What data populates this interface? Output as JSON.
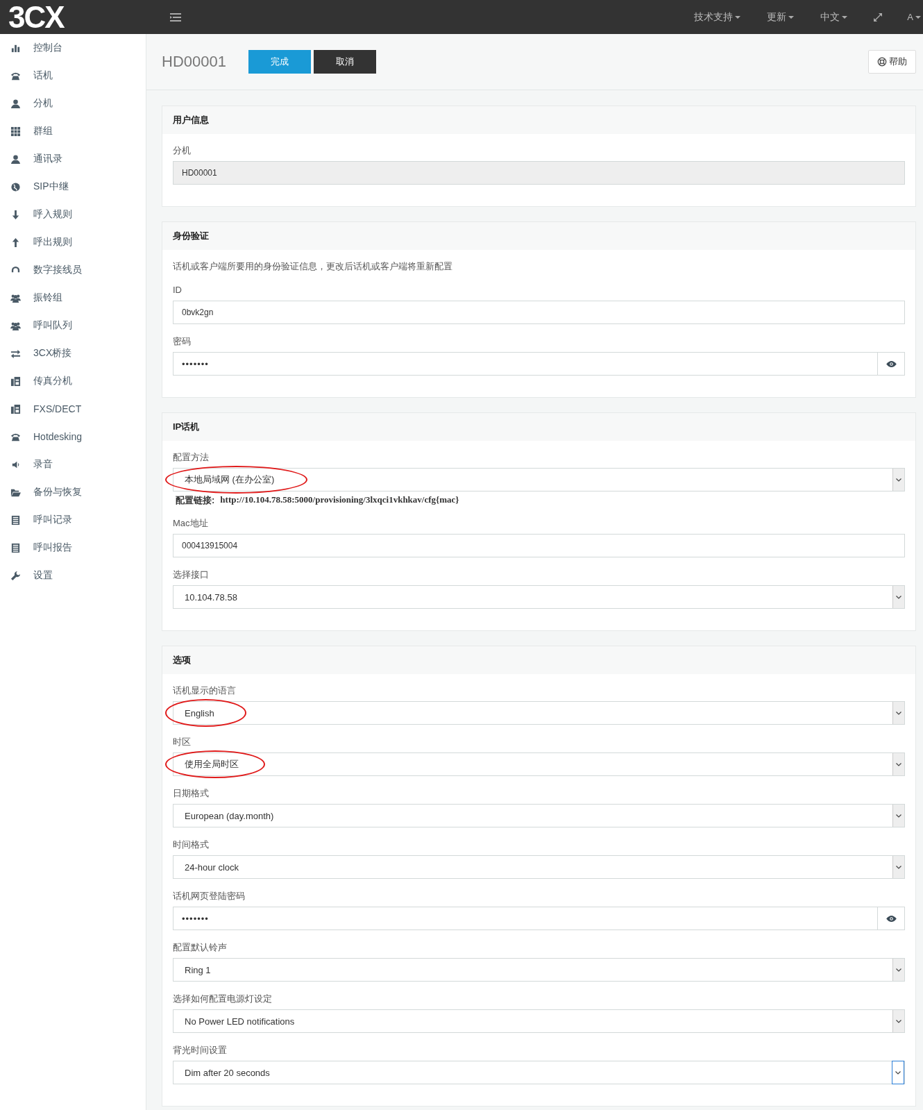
{
  "header": {
    "logo": "3CX",
    "menus": [
      {
        "label": "技术支持"
      },
      {
        "label": "更新"
      },
      {
        "label": "中文"
      }
    ],
    "user": "A"
  },
  "sidebar": {
    "items": [
      {
        "label": "控制台"
      },
      {
        "label": "话机"
      },
      {
        "label": "分机"
      },
      {
        "label": "群组"
      },
      {
        "label": "通讯录"
      },
      {
        "label": "SIP中继"
      },
      {
        "label": "呼入规则"
      },
      {
        "label": "呼出规则"
      },
      {
        "label": "数字接线员"
      },
      {
        "label": "振铃组"
      },
      {
        "label": "呼叫队列"
      },
      {
        "label": "3CX桥接"
      },
      {
        "label": "传真分机"
      },
      {
        "label": "FXS/DECT"
      },
      {
        "label": "Hotdesking"
      },
      {
        "label": "录音"
      },
      {
        "label": "备份与恢复"
      },
      {
        "label": "呼叫记录"
      },
      {
        "label": "呼叫报告"
      },
      {
        "label": "设置"
      }
    ]
  },
  "page": {
    "title": "HD00001",
    "buttons": [
      {
        "label": "完成",
        "kind": "primary"
      },
      {
        "label": "取消",
        "kind": "dark"
      }
    ],
    "help": "帮助"
  },
  "panels": [
    {
      "title": "用户信息",
      "fields": [
        {
          "kind": "readonly",
          "label": "分机",
          "value": "HD00001"
        }
      ]
    },
    {
      "title": "身份验证",
      "description": "话机或客户端所要用的身份验证信息，更改后话机或客户端将重新配置",
      "fields": [
        {
          "kind": "text",
          "label": "ID",
          "value": "0bvk2gn"
        },
        {
          "kind": "password",
          "label": "密码",
          "value": "•••••••"
        }
      ]
    },
    {
      "title": "IP话机",
      "fields": [
        {
          "kind": "select",
          "label": "配置方法",
          "value": "本地局域网 (在办公室)",
          "circled": true,
          "focused": false
        },
        {
          "kind": "note",
          "label": "配置链接:",
          "value": "http://10.104.78.58:5000/provisioning/3lxqci1vkhkav/cfg{mac}"
        },
        {
          "kind": "text",
          "label": "Mac地址",
          "value": "000413915004"
        },
        {
          "kind": "select",
          "label": "选择接口",
          "value": "10.104.78.58",
          "circled": false,
          "focused": false
        }
      ]
    },
    {
      "title": "选项",
      "fields": [
        {
          "kind": "select",
          "label": "话机显示的语言",
          "value": "English",
          "circled": true,
          "focused": false
        },
        {
          "kind": "select",
          "label": "时区",
          "value": "使用全局时区",
          "circled": true,
          "focused": false
        },
        {
          "kind": "select",
          "label": "日期格式",
          "value": "European (day.month)",
          "circled": false,
          "focused": false
        },
        {
          "kind": "select",
          "label": "时间格式",
          "value": "24-hour clock",
          "circled": false,
          "focused": false
        },
        {
          "kind": "password",
          "label": "话机网页登陆密码",
          "value": "•••••••"
        },
        {
          "kind": "select",
          "label": "配置默认铃声",
          "value": "Ring 1",
          "circled": false,
          "focused": false
        },
        {
          "kind": "select",
          "label": "选择如何配置电源灯设定",
          "value": "No Power LED notifications",
          "circled": false,
          "focused": false
        },
        {
          "kind": "select",
          "label": "背光时间设置",
          "value": "Dim after 20 seconds",
          "circled": false,
          "focused": true
        }
      ]
    }
  ]
}
